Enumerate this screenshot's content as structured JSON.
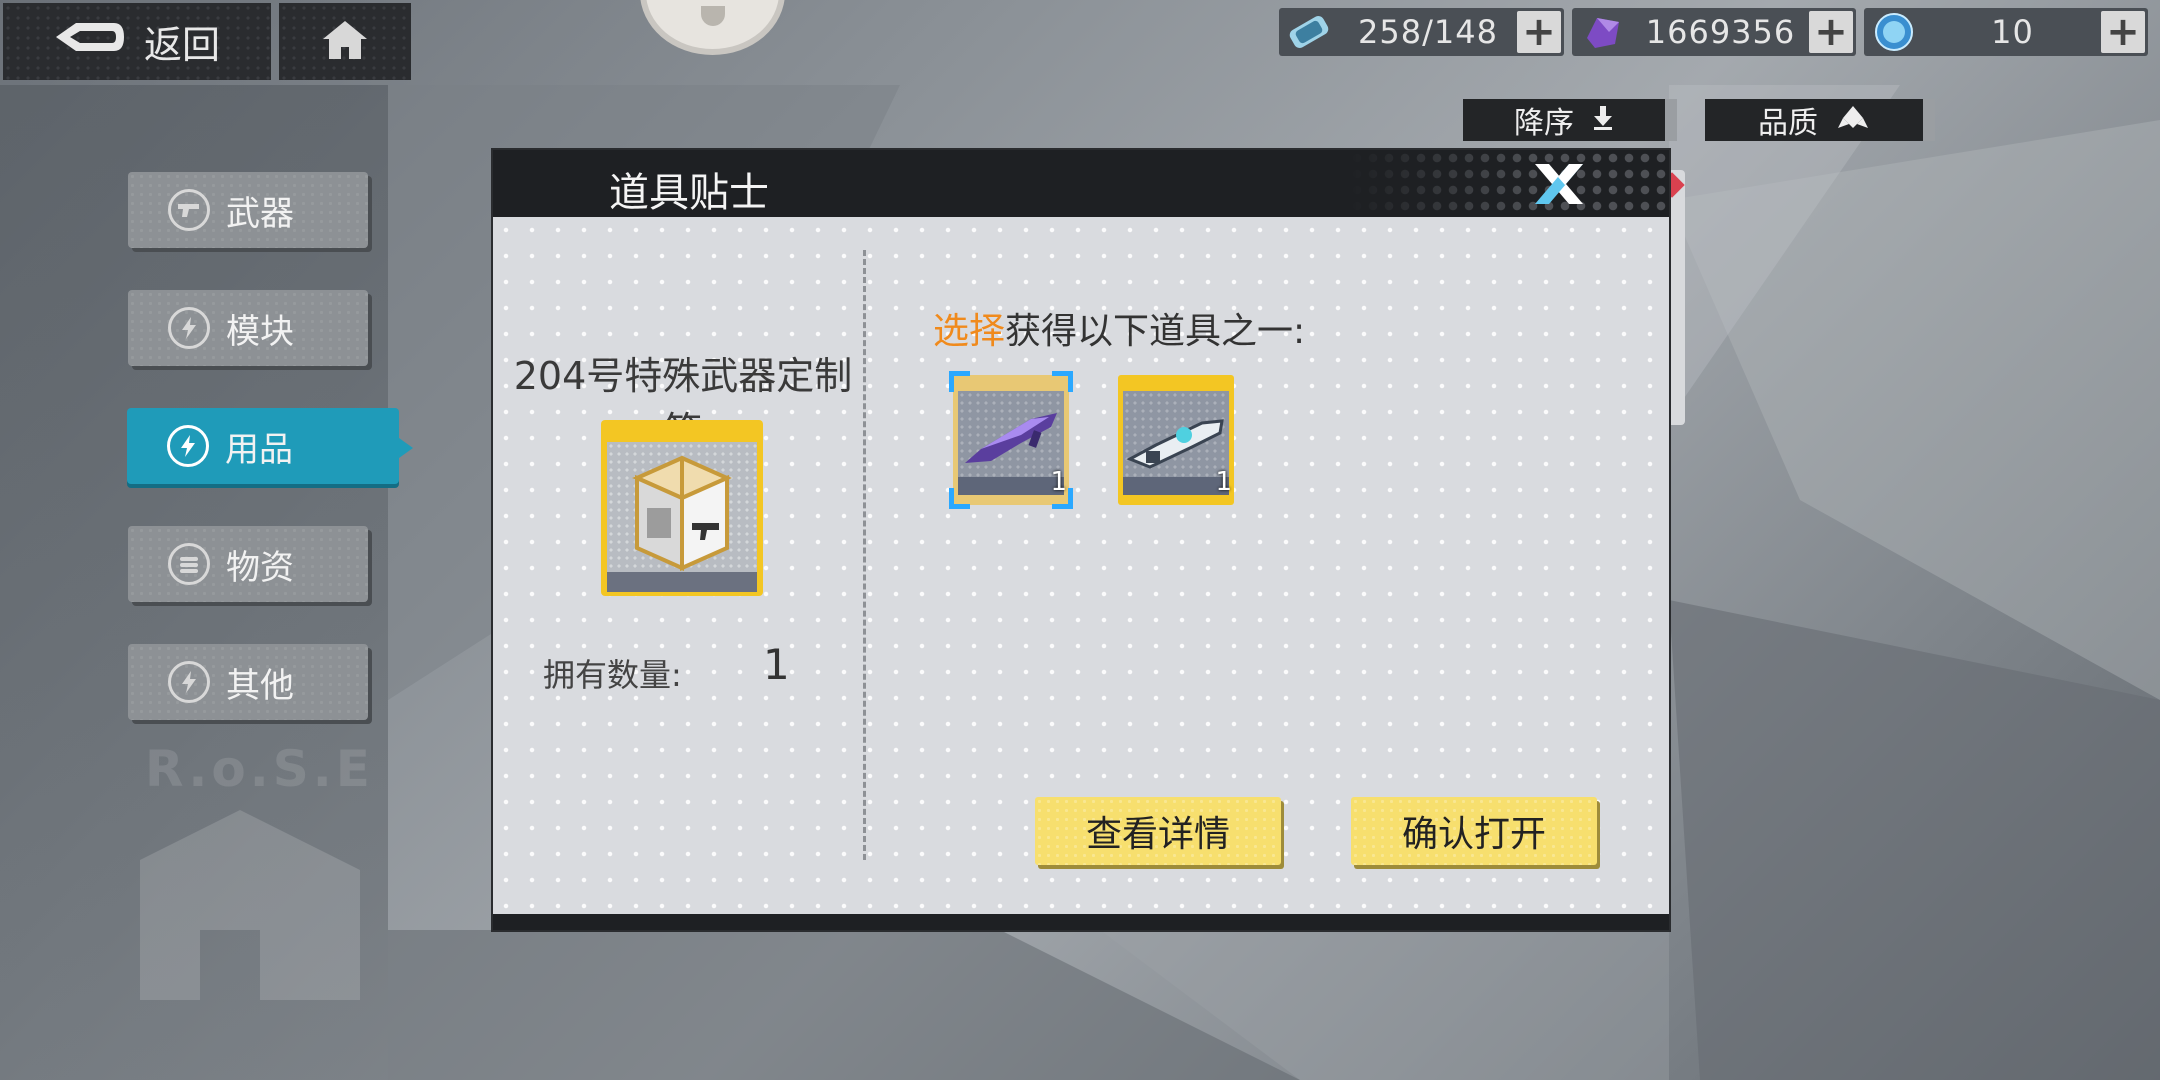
{
  "topbar": {
    "back_label": "返回"
  },
  "resources": [
    {
      "icon": "energy-canister-icon",
      "value": "258/148"
    },
    {
      "icon": "purple-crystal-icon",
      "value": "1669356"
    },
    {
      "icon": "blue-orb-icon",
      "value": "10"
    }
  ],
  "sort": {
    "order_label": "降序",
    "quality_label": "品质"
  },
  "categories": [
    {
      "label": "武器",
      "icon": "gun-icon"
    },
    {
      "label": "模块",
      "icon": "bolt-icon"
    },
    {
      "label": "用品",
      "icon": "bolt-icon",
      "active": true
    },
    {
      "label": "物资",
      "icon": "supply-icon"
    },
    {
      "label": "其他",
      "icon": "bolt-icon"
    }
  ],
  "watermark": "R.o.S.E",
  "dialog": {
    "title": "道具贴士",
    "box_name": "204号特殊武器定制箱",
    "own_label": "拥有数量:",
    "own_value": "1",
    "choose_highlight": "选择",
    "choose_rest": "获得以下道具之一:",
    "items": [
      {
        "name": "purple-weapon",
        "qty": "1",
        "selected": true
      },
      {
        "name": "white-weapon",
        "qty": "1",
        "selected": false
      }
    ],
    "details_button": "查看详情",
    "confirm_button": "确认打开"
  },
  "colors": {
    "accent_blue": "#1f9bb9",
    "button_yellow": "#f7df6e",
    "highlight_orange": "#f08a1c",
    "selection_blue": "#2aa8ff",
    "card_gold": "#f3c623"
  }
}
